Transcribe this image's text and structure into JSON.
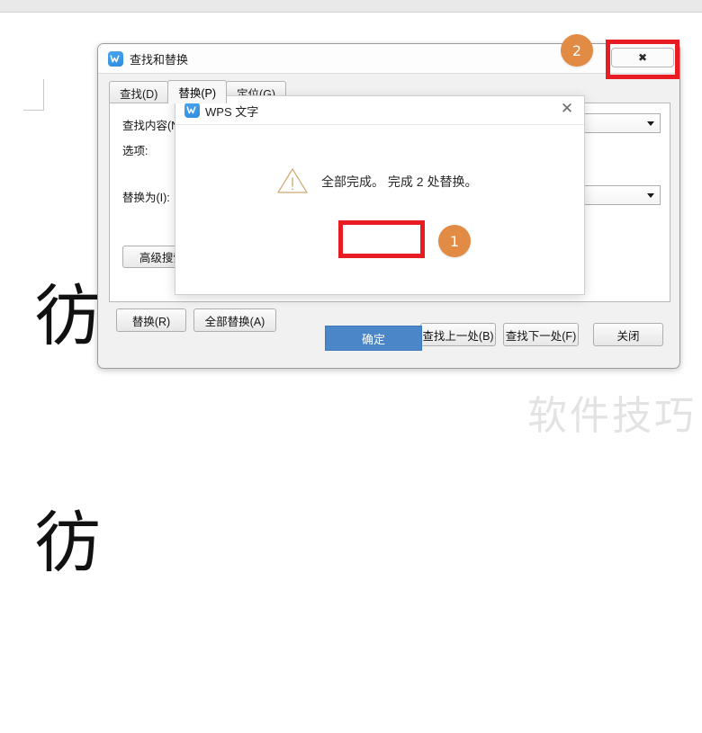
{
  "document": {
    "characters": [
      "彷",
      "彷"
    ],
    "watermark": "软件技巧"
  },
  "find_replace_dialog": {
    "title": "查找和替换",
    "logo_icon": "wps-logo-icon",
    "close_button_icon": "close-x-icon",
    "close_button_glyph": "✖",
    "tabs": [
      {
        "label": "查找(D)",
        "active": false
      },
      {
        "label": "替换(P)",
        "active": true
      },
      {
        "label": "定位(G)",
        "active": false
      }
    ],
    "fields": {
      "find_label": "查找内容(N",
      "find_value": "",
      "options_label": "选项:",
      "options_value": "",
      "replace_label": "替换为(I):",
      "replace_value": "",
      "dropdown_icon": "chevron-down-icon"
    },
    "buttons": {
      "advanced_search": "高级搜索(",
      "replace": "替换(R)",
      "replace_all": "全部替换(A)",
      "find_prev": "查找上一处(B)",
      "find_next": "查找下一处(F)",
      "close": "关闭"
    }
  },
  "message_dialog": {
    "title": "WPS 文字",
    "logo_icon": "wps-logo-icon",
    "close_icon": "close-icon",
    "close_glyph": "✕",
    "warning_icon": "warning-triangle-icon",
    "message": "全部完成。 完成 2 处替换。",
    "replacements_count": 2,
    "ok_button": "确定"
  },
  "annotations": {
    "badges": [
      {
        "label": "1",
        "target": "ok-button"
      },
      {
        "label": "2",
        "target": "find-replace-close-button"
      }
    ],
    "highlight_color": "#e81c23",
    "badge_color": "#e28b45",
    "accent_button_color": "#4a86c8"
  }
}
